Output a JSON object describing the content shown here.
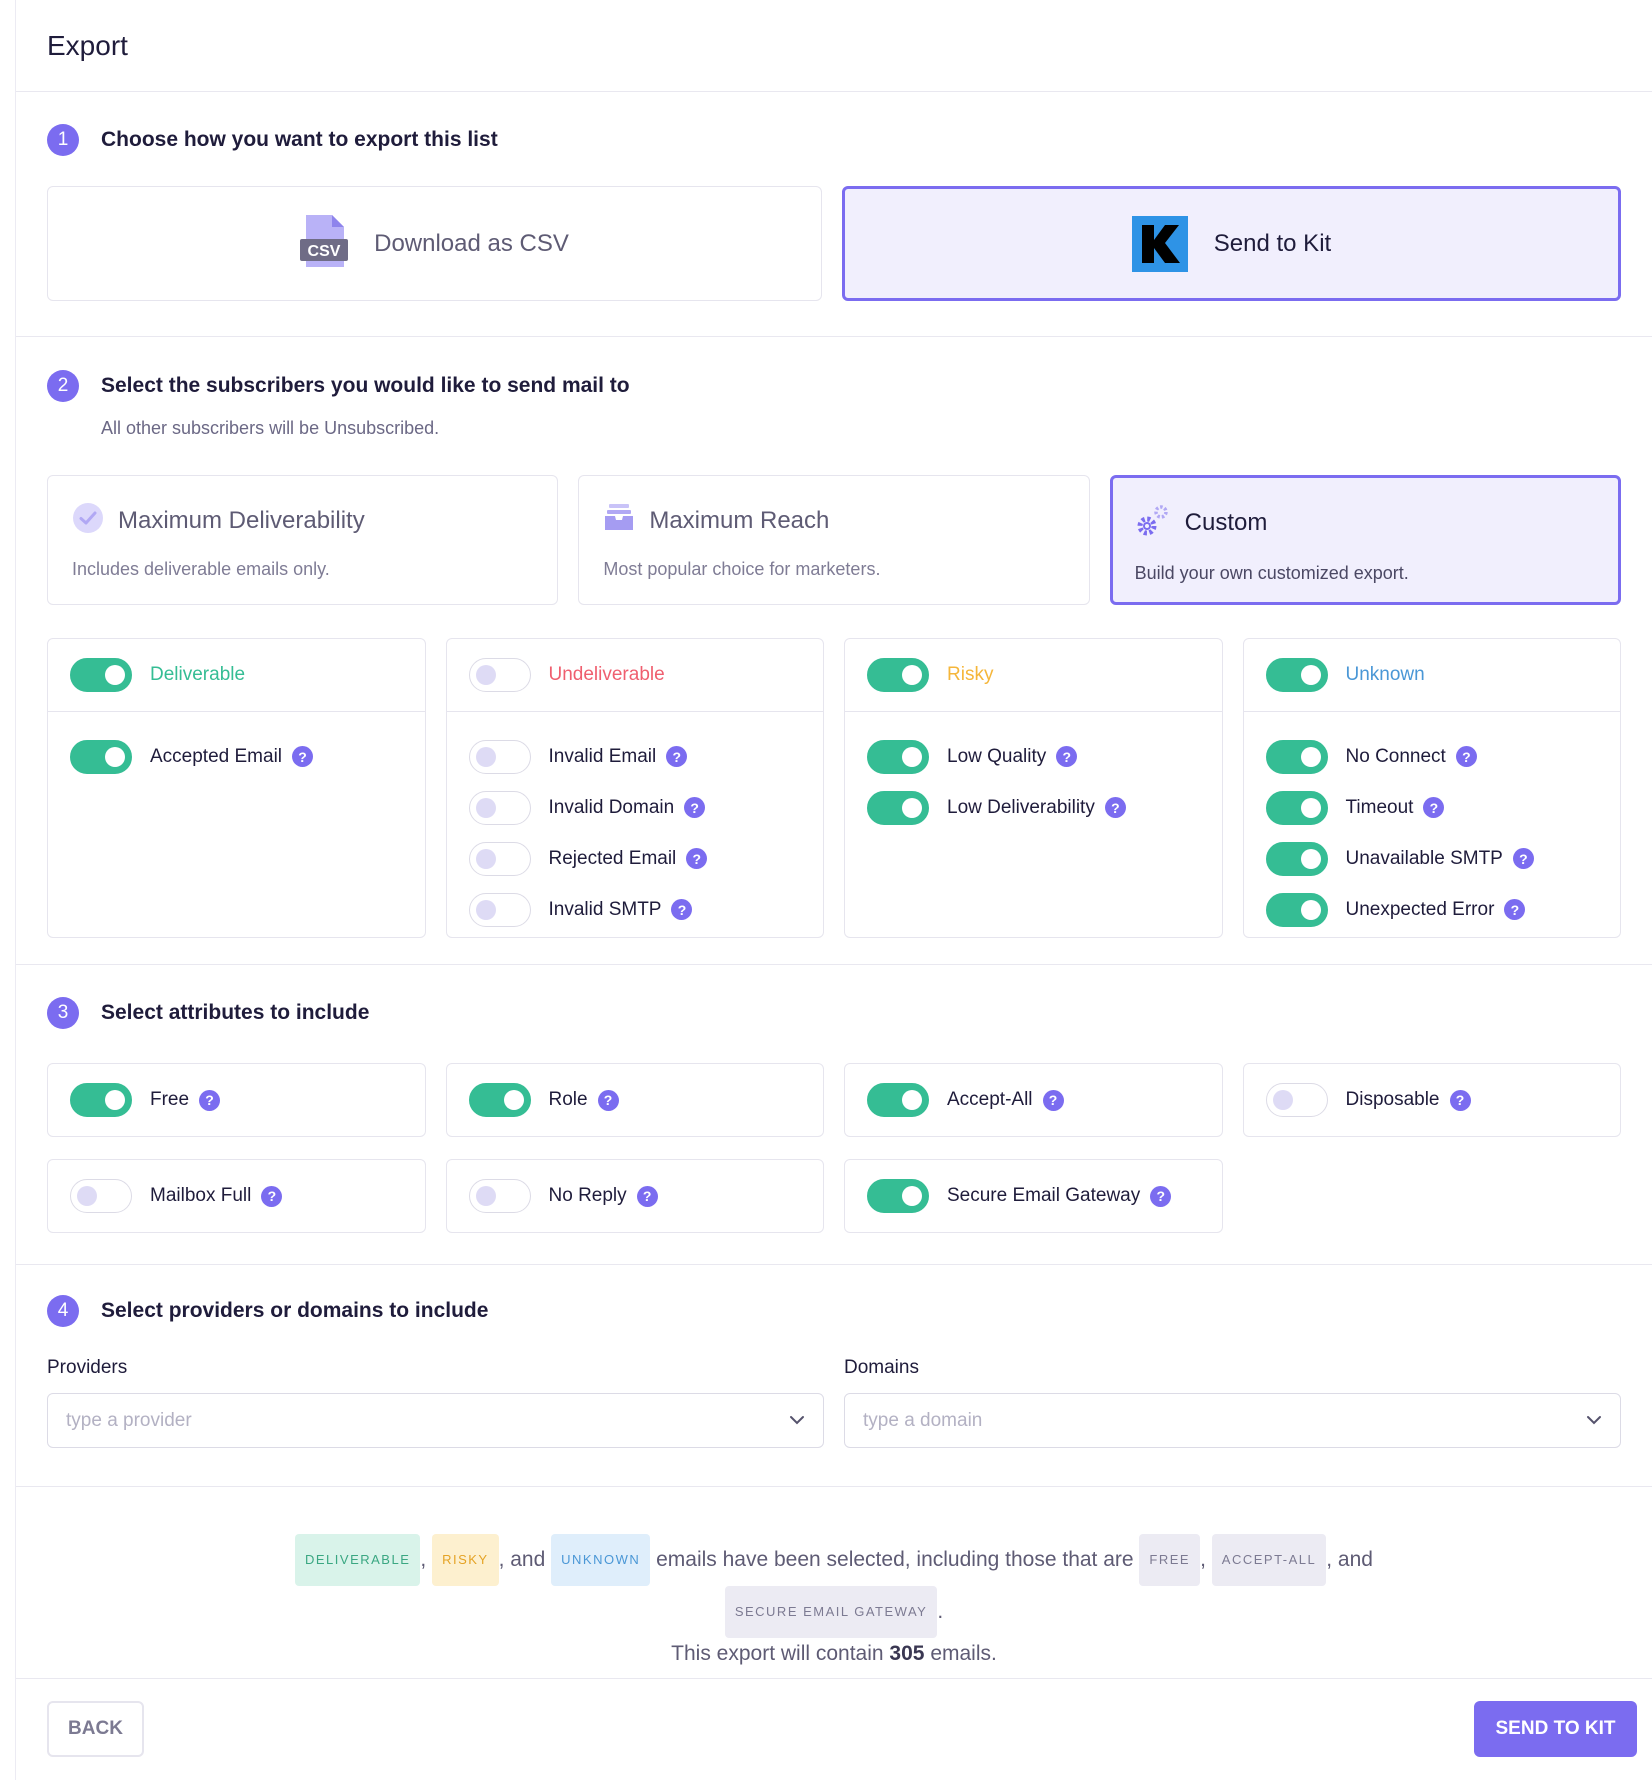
{
  "header": {
    "title": "Export"
  },
  "step1": {
    "num": "1",
    "title": "Choose how you want to export this list",
    "options": [
      {
        "label": "Download as CSV",
        "icon": "csv-file-icon",
        "selected": false
      },
      {
        "label": "Send to Kit",
        "icon": "kit-logo-icon",
        "selected": true
      }
    ],
    "csv_icon_text": "CSV"
  },
  "step2": {
    "num": "2",
    "title": "Select the subscribers you would like to send mail to",
    "subtitle": "All other subscribers will be Unsubscribed.",
    "presets": [
      {
        "title": "Maximum Deliverability",
        "desc": "Includes deliverable emails only.",
        "icon": "check-circle-icon"
      },
      {
        "title": "Maximum Reach",
        "desc": "Most popular choice for marketers.",
        "icon": "inbox-tray-icon"
      },
      {
        "title": "Custom",
        "desc": "Build your own customized export.",
        "icon": "gears-icon",
        "selected": true
      }
    ],
    "categories": [
      {
        "name": "Deliverable",
        "color": "#35bd94",
        "on": true,
        "items": [
          {
            "label": "Accepted Email",
            "on": true
          }
        ]
      },
      {
        "name": "Undeliverable",
        "color": "#ef5f6f",
        "on": false,
        "items": [
          {
            "label": "Invalid Email",
            "on": false
          },
          {
            "label": "Invalid Domain",
            "on": false
          },
          {
            "label": "Rejected Email",
            "on": false
          },
          {
            "label": "Invalid SMTP",
            "on": false
          }
        ]
      },
      {
        "name": "Risky",
        "color": "#f5b63a",
        "on": true,
        "items": [
          {
            "label": "Low Quality",
            "on": true
          },
          {
            "label": "Low Deliverability",
            "on": true
          }
        ]
      },
      {
        "name": "Unknown",
        "color": "#4a97d6",
        "on": true,
        "items": [
          {
            "label": "No Connect",
            "on": true
          },
          {
            "label": "Timeout",
            "on": true
          },
          {
            "label": "Unavailable SMTP",
            "on": true
          },
          {
            "label": "Unexpected Error",
            "on": true
          }
        ]
      }
    ]
  },
  "step3": {
    "num": "3",
    "title": "Select attributes to include",
    "attributes": [
      {
        "label": "Free",
        "on": true
      },
      {
        "label": "Role",
        "on": true
      },
      {
        "label": "Accept-All",
        "on": true
      },
      {
        "label": "Disposable",
        "on": false
      },
      {
        "label": "Mailbox Full",
        "on": false
      },
      {
        "label": "No Reply",
        "on": false
      },
      {
        "label": "Secure Email Gateway",
        "on": true
      }
    ]
  },
  "step4": {
    "num": "4",
    "title": "Select providers or domains to include",
    "providers": {
      "label": "Providers",
      "placeholder": "type a provider",
      "value": ""
    },
    "domains": {
      "label": "Domains",
      "placeholder": "type a domain",
      "value": ""
    }
  },
  "summary": {
    "badge_deliverable": "DELIVERABLE",
    "badge_risky": "RISKY",
    "badge_unknown": "UNKNOWN",
    "sep_comma": ",",
    "sep_and": ", and",
    "mid_text": "emails have been selected, including those that are",
    "badge_free": "FREE",
    "badge_acceptall": "ACCEPT-ALL",
    "tail_and": ", and",
    "badge_seg": "SECURE EMAIL GATEWAY",
    "end_period": ".",
    "count_prefix": "This export will contain",
    "count": "305",
    "count_suffix": "emails."
  },
  "footer": {
    "back_label": "BACK",
    "send_label": "SEND TO KIT"
  },
  "colors": {
    "accent": "#7b6cf0",
    "toggle_on": "#35bd94"
  }
}
